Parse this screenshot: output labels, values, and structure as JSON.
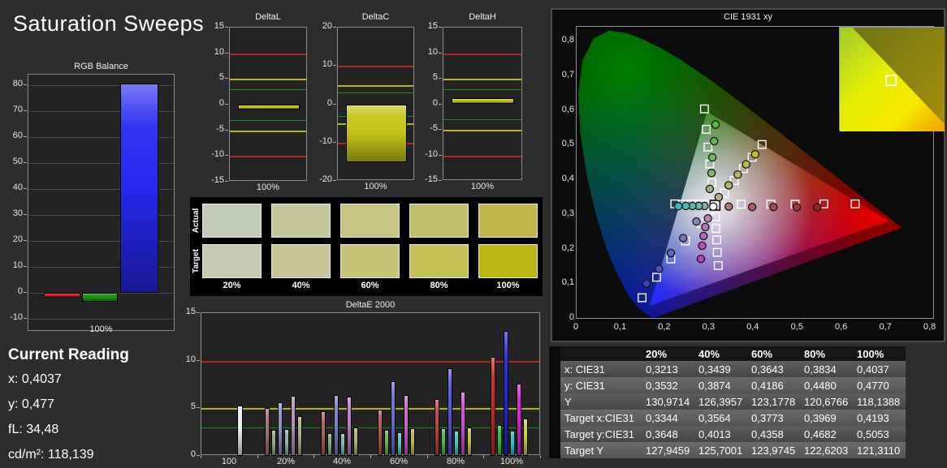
{
  "page_title": "Saturation Sweeps",
  "current_reading": {
    "heading": "Current Reading",
    "lines": [
      "x: 0,4037",
      "y: 0,477",
      "fL: 34,48",
      "cd/m²: 118,139"
    ]
  },
  "colors": {
    "background": "#2d2d2d",
    "plot_background": "#232323",
    "plot_border": "#8c8c8c",
    "grid": "#4a4a4a",
    "limit_red": "#b22525",
    "limit_yellow": "#b5b517",
    "limit_green": "#1d8a1d",
    "delta_bar_yellow": "#c4c416",
    "rgb_red": "#dd1c1c",
    "rgb_green": "#169616",
    "rgb_blue": "#2727f0"
  },
  "chart_data": [
    {
      "id": "rgb-balance",
      "type": "bar",
      "title": "RGB Balance",
      "xlabel": "100%",
      "ylim": [
        -15,
        84
      ],
      "yticks": [
        80,
        70,
        60,
        50,
        40,
        30,
        20,
        10,
        0,
        -10
      ],
      "grid": true,
      "categories": [
        "red",
        "green",
        "blue"
      ],
      "values": [
        -2,
        -3.5,
        80.5
      ],
      "bar_colors": [
        "#dd1c1c",
        "#169616",
        "#2727f0"
      ]
    },
    {
      "id": "delta-l",
      "type": "bar",
      "title": "DeltaL",
      "xlabel": "100%",
      "ylim": [
        -15,
        15
      ],
      "yticks": [
        15,
        10,
        5,
        0,
        -5,
        -10,
        -15
      ],
      "limit_lines": [
        {
          "value": 10,
          "color": "#b22525",
          "mirror": true,
          "thick": 2
        },
        {
          "value": 5,
          "color": "#b5b517",
          "mirror": true,
          "thick": 2
        },
        {
          "value": 3,
          "color": "#1d8a1d",
          "mirror": true,
          "thick": 1
        }
      ],
      "categories": [
        "100%"
      ],
      "values": [
        -1.0
      ],
      "bar_colors": [
        "#c4c416"
      ]
    },
    {
      "id": "delta-c",
      "type": "bar",
      "title": "DeltaC",
      "xlabel": "100%",
      "ylim": [
        -20,
        20
      ],
      "yticks": [
        20,
        10,
        0,
        -10,
        -20
      ],
      "limit_lines": [
        {
          "value": 10,
          "color": "#b22525",
          "mirror": true,
          "thick": 2
        },
        {
          "value": 5,
          "color": "#b5b517",
          "mirror": true,
          "thick": 2
        },
        {
          "value": 3,
          "color": "#1d8a1d",
          "mirror": true,
          "thick": 1
        }
      ],
      "categories": [
        "100%"
      ],
      "values": [
        -15.2
      ],
      "bar_colors": [
        "#c4c416"
      ]
    },
    {
      "id": "delta-h",
      "type": "bar",
      "title": "DeltaH",
      "xlabel": "100%",
      "ylim": [
        -15,
        15
      ],
      "yticks": [
        15,
        10,
        5,
        0,
        -5,
        -10,
        -15
      ],
      "limit_lines": [
        {
          "value": 10,
          "color": "#b22525",
          "mirror": true,
          "thick": 2
        },
        {
          "value": 5,
          "color": "#b5b517",
          "mirror": true,
          "thick": 2
        },
        {
          "value": 3,
          "color": "#1d8a1d",
          "mirror": true,
          "thick": 1
        }
      ],
      "categories": [
        "100%"
      ],
      "values": [
        1.2
      ],
      "bar_colors": [
        "#c4c416"
      ]
    },
    {
      "id": "saturation-swatches",
      "type": "table",
      "row_labels": [
        "Actual",
        "Target"
      ],
      "col_labels": [
        "20%",
        "40%",
        "60%",
        "80%",
        "100%"
      ],
      "actual_colors": [
        "#c5cbba",
        "#c4c69c",
        "#c7c584",
        "#c4bf6a",
        "#c0b54a"
      ],
      "target_colors": [
        "#c9cab4",
        "#c8c696",
        "#c8c578",
        "#c5c257",
        "#bdb415"
      ]
    },
    {
      "id": "delta-e-2000",
      "type": "bar",
      "title": "DeltaE 2000",
      "ylim": [
        0,
        15
      ],
      "yticks": [
        15,
        10,
        5,
        0
      ],
      "limit_lines": [
        {
          "value": 10,
          "color": "#b22525",
          "mirror": false,
          "thick": 2
        },
        {
          "value": 5,
          "color": "#b5b517",
          "mirror": false,
          "thick": 2
        },
        {
          "value": 3,
          "color": "#1d8a1d",
          "mirror": false,
          "thick": 1
        }
      ],
      "groups": [
        {
          "label": "100",
          "values": [
            5.3
          ],
          "colors": [
            "#ececec"
          ]
        },
        {
          "label": "20%",
          "values": [
            5.0,
            2.7,
            5.6,
            2.8,
            6.3,
            4.2
          ],
          "colors": [
            "#ab7070",
            "#8fae85",
            "#8c90c3",
            "#8fb3ae",
            "#b08fbc",
            "#adad85"
          ]
        },
        {
          "label": "40%",
          "values": [
            4.7,
            2.4,
            6.4,
            2.4,
            6.2,
            3.0
          ],
          "colors": [
            "#b06262",
            "#7cb273",
            "#7b80c9",
            "#78bcb4",
            "#bb7cc2",
            "#b2b26b"
          ]
        },
        {
          "label": "60%",
          "values": [
            4.9,
            2.7,
            7.8,
            2.5,
            6.4,
            2.9
          ],
          "colors": [
            "#b85454",
            "#68b562",
            "#6a6fd0",
            "#5fc2ba",
            "#c668c8",
            "#b8b852"
          ]
        },
        {
          "label": "80%",
          "values": [
            6.0,
            2.9,
            9.2,
            2.6,
            6.7,
            3.0
          ],
          "colors": [
            "#c24242",
            "#4fbc4a",
            "#5558d9",
            "#44cac2",
            "#d14fd4",
            "#c2c23c"
          ]
        },
        {
          "label": "100%",
          "values": [
            10.4,
            3.2,
            13.1,
            2.6,
            7.6,
            3.9
          ],
          "colors": [
            "#d92222",
            "#22cc22",
            "#2224ea",
            "#16d2cc",
            "#e01ce0",
            "#d2d218"
          ]
        }
      ]
    },
    {
      "id": "cie-1931",
      "type": "scatter",
      "title": "CIE 1931 xy",
      "xlim": [
        0,
        0.81
      ],
      "ylim": [
        0,
        0.845
      ],
      "xtick_labels": [
        "0",
        "0,1",
        "0,2",
        "0,3",
        "0,4",
        "0,5",
        "0,6",
        "0,7",
        "0,8"
      ],
      "ytick_labels": [
        "0",
        "0,1",
        "0,2",
        "0,3",
        "0,4",
        "0,5",
        "0,6",
        "0,7",
        "0,8"
      ],
      "white_target": {
        "x": 0.313,
        "y": 0.33
      },
      "white_measured": {
        "x": 0.309,
        "y": 0.326
      },
      "sweeps": [
        {
          "name": "red",
          "targets": [
            [
              0.372,
              0.333
            ],
            [
              0.439,
              0.333
            ],
            [
              0.494,
              0.333
            ],
            [
              0.559,
              0.334
            ],
            [
              0.63,
              0.334
            ]
          ],
          "measured": [
            [
              0.344,
              0.326
            ],
            [
              0.397,
              0.325
            ],
            [
              0.445,
              0.325
            ],
            [
              0.498,
              0.324
            ],
            [
              0.544,
              0.324
            ]
          ],
          "point_colors": [
            "#b07575",
            "#ad5f5f",
            "#a84a4a",
            "#a23636",
            "#992424"
          ]
        },
        {
          "name": "green",
          "targets": [
            [
              0.306,
              0.395
            ],
            [
              0.301,
              0.449
            ],
            [
              0.297,
              0.498
            ],
            [
              0.293,
              0.549
            ],
            [
              0.289,
              0.608
            ]
          ],
          "measured": [
            [
              0.301,
              0.377
            ],
            [
              0.305,
              0.423
            ],
            [
              0.307,
              0.468
            ],
            [
              0.311,
              0.515
            ],
            [
              0.314,
              0.563
            ]
          ],
          "point_colors": [
            "#93b285",
            "#83b573",
            "#72b861",
            "#60bb4e",
            "#4dbe3a"
          ]
        },
        {
          "name": "blue",
          "targets": [
            [
              0.282,
              0.278
            ],
            [
              0.246,
              0.227
            ],
            [
              0.213,
              0.175
            ],
            [
              0.181,
              0.122
            ],
            [
              0.148,
              0.063
            ]
          ],
          "measured": [
            [
              0.271,
              0.283
            ],
            [
              0.241,
              0.235
            ],
            [
              0.213,
              0.192
            ],
            [
              0.186,
              0.146
            ],
            [
              0.158,
              0.104
            ]
          ],
          "point_colors": [
            "#8588b8",
            "#7276bb",
            "#5f64be",
            "#4c52c1",
            "#3a40c4"
          ]
        },
        {
          "name": "cyan",
          "targets": [
            [
              0.295,
              0.333
            ],
            [
              0.277,
              0.333
            ],
            [
              0.259,
              0.333
            ],
            [
              0.24,
              0.333
            ],
            [
              0.222,
              0.334
            ]
          ],
          "measured": [
            [
              0.289,
              0.328
            ],
            [
              0.276,
              0.328
            ],
            [
              0.262,
              0.328
            ],
            [
              0.247,
              0.328
            ],
            [
              0.23,
              0.327
            ]
          ],
          "point_colors": [
            "#85b2ae",
            "#73b5b0",
            "#61b8b2",
            "#4ebbb4",
            "#3abeb6"
          ]
        },
        {
          "name": "magenta",
          "targets": [
            [
              0.314,
              0.296
            ],
            [
              0.315,
              0.263
            ],
            [
              0.317,
              0.23
            ],
            [
              0.318,
              0.194
            ],
            [
              0.32,
              0.156
            ]
          ],
          "measured": [
            [
              0.297,
              0.292
            ],
            [
              0.291,
              0.267
            ],
            [
              0.287,
              0.241
            ],
            [
              0.284,
              0.213
            ],
            [
              0.281,
              0.175
            ]
          ],
          "point_colors": [
            "#b285b2",
            "#b573b5",
            "#b861b8",
            "#bb4ebb",
            "#be3abe"
          ]
        },
        {
          "name": "yellow",
          "targets": [
            [
              0.3344,
              0.3648
            ],
            [
              0.3564,
              0.4013
            ],
            [
              0.3773,
              0.4358
            ],
            [
              0.3969,
              0.4682
            ],
            [
              0.4193,
              0.5053
            ]
          ],
          "measured": [
            [
              0.3213,
              0.3532
            ],
            [
              0.3439,
              0.3874
            ],
            [
              0.3643,
              0.4186
            ],
            [
              0.3834,
              0.448
            ],
            [
              0.4037,
              0.477
            ]
          ],
          "point_colors": [
            "#b2b285",
            "#b5b573",
            "#b8b861",
            "#bbbb4e",
            "#bebe3a"
          ]
        }
      ],
      "inset": {
        "marker_x": 0.49,
        "marker_y": 0.51
      }
    },
    {
      "id": "measurement-table",
      "type": "table",
      "columns": [
        "",
        "20%",
        "40%",
        "60%",
        "80%",
        "100%"
      ],
      "rows": [
        {
          "label": "x: CIE31",
          "values": [
            "0,3213",
            "0,3439",
            "0,3643",
            "0,3834",
            "0,4037"
          ]
        },
        {
          "label": "y: CIE31",
          "values": [
            "0,3532",
            "0,3874",
            "0,4186",
            "0,4480",
            "0,4770"
          ]
        },
        {
          "label": "Y",
          "values": [
            "130,9714",
            "126,3957",
            "123,1778",
            "120,6766",
            "118,1388"
          ]
        },
        {
          "label": "Target x:CIE31",
          "values": [
            "0,3344",
            "0,3564",
            "0,3773",
            "0,3969",
            "0,4193"
          ]
        },
        {
          "label": "Target y:CIE31",
          "values": [
            "0,3648",
            "0,4013",
            "0,4358",
            "0,4682",
            "0,5053"
          ]
        },
        {
          "label": "Target Y",
          "values": [
            "127,9459",
            "125,7001",
            "123,9745",
            "122,6203",
            "121,3110"
          ]
        }
      ]
    }
  ]
}
